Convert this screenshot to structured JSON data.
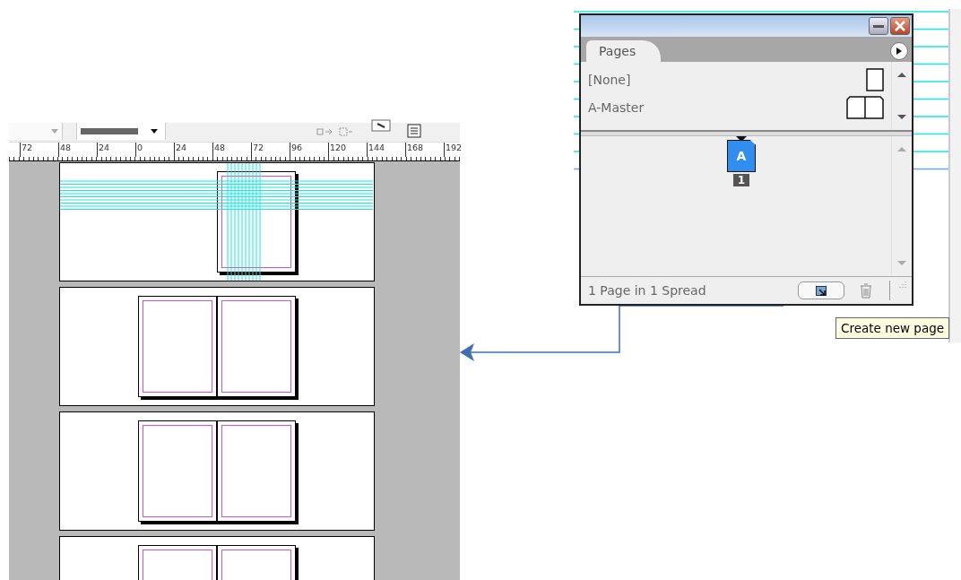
{
  "ruler": {
    "labels": [
      "72",
      "48",
      "24",
      "0",
      "24",
      "48",
      "72",
      "96",
      "120",
      "144",
      "168",
      "192"
    ]
  },
  "spreads": [
    {
      "kind": "single"
    },
    {
      "kind": "facing"
    },
    {
      "kind": "facing"
    },
    {
      "kind": "facing"
    }
  ],
  "panel": {
    "tab": "Pages",
    "masters": [
      {
        "name": "[None]",
        "kind": "single"
      },
      {
        "name": "A-Master",
        "kind": "facing"
      }
    ],
    "page": {
      "master": "A",
      "number": "1"
    },
    "status": "1 Page in 1 Spread"
  },
  "tooltip": "Create new page"
}
